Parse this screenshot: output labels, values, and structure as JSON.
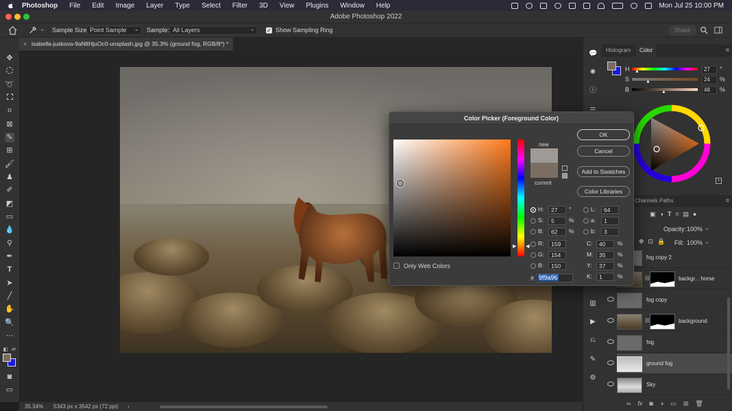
{
  "menubar": {
    "app": "Photoshop",
    "items": [
      "File",
      "Edit",
      "Image",
      "Layer",
      "Type",
      "Select",
      "Filter",
      "3D",
      "View",
      "Plugins",
      "Window",
      "Help"
    ],
    "clock": "Mon Jul 25  10:00 PM"
  },
  "window": {
    "title": "Adobe Photoshop 2022"
  },
  "options": {
    "sample_size_label": "Sample Size:",
    "sample_size_value": "Point Sample",
    "sample_label": "Sample:",
    "sample_value": "All Layers",
    "show_ring_label": "Show Sampling Ring",
    "share_label": "Share"
  },
  "document": {
    "tab_title": "isabella-juskova-9aNltHjuOc0-unsplash.jpg @ 35.3% (ground fog, RGB/8*) *"
  },
  "status": {
    "zoom": "35.34%",
    "size": "5343 px x 3542 px (72 ppi)"
  },
  "color_panel": {
    "tabs": [
      "Histogram",
      "Color"
    ],
    "active_tab": "Color",
    "h": {
      "label": "H",
      "value": "27",
      "unit": "°",
      "level": 0.08
    },
    "s": {
      "label": "S",
      "value": "24",
      "unit": "%",
      "level": 0.24
    },
    "b": {
      "label": "B",
      "value": "48",
      "unit": "%",
      "level": 0.48
    }
  },
  "layers_panel": {
    "tabs": [
      "Channels",
      "Paths"
    ],
    "opacity_label": "Opacity:",
    "opacity_value": "100%",
    "fill_label": "Fill:",
    "fill_value": "100%",
    "layers": [
      {
        "name": "fog copy 2",
        "mask": false,
        "selected": false
      },
      {
        "name": "backgr... horse",
        "mask": true,
        "selected": false
      },
      {
        "name": "fog copy",
        "mask": false,
        "selected": false
      },
      {
        "name": "background",
        "mask": true,
        "selected": false
      },
      {
        "name": "fog",
        "mask": false,
        "selected": false
      },
      {
        "name": "ground fog",
        "mask": false,
        "selected": true
      },
      {
        "name": "Sky",
        "mask": false,
        "selected": false
      }
    ]
  },
  "color_picker": {
    "title": "Color Picker (Foreground Color)",
    "ok_label": "OK",
    "cancel_label": "Cancel",
    "swatches_label": "Add to Swatches",
    "libraries_label": "Color Libraries",
    "new_label": "new",
    "current_label": "current",
    "new_color": "#9f9a96",
    "current_color": "#7a6e63",
    "web_colors_label": "Only Web Colors",
    "hsb": [
      {
        "label": "H:",
        "value": "27",
        "unit": "°",
        "selected": true
      },
      {
        "label": "S:",
        "value": "5",
        "unit": "%",
        "selected": false
      },
      {
        "label": "B:",
        "value": "62",
        "unit": "%",
        "selected": false
      }
    ],
    "rgb": [
      {
        "label": "R:",
        "value": "159"
      },
      {
        "label": "G:",
        "value": "154"
      },
      {
        "label": "B:",
        "value": "150"
      }
    ],
    "lab": [
      {
        "label": "L:",
        "value": "64"
      },
      {
        "label": "a:",
        "value": "1"
      },
      {
        "label": "b:",
        "value": "3"
      }
    ],
    "cmyk": [
      {
        "label": "C:",
        "value": "40",
        "unit": "%"
      },
      {
        "label": "M:",
        "value": "35",
        "unit": "%"
      },
      {
        "label": "Y:",
        "value": "37",
        "unit": "%"
      },
      {
        "label": "K:",
        "value": "1",
        "unit": "%"
      }
    ],
    "hex_label": "#",
    "hex_value": "9f9a96"
  },
  "colors": {
    "foreground": "#7a6e63",
    "background": "#1a1adf",
    "accent": "#1473e6"
  }
}
